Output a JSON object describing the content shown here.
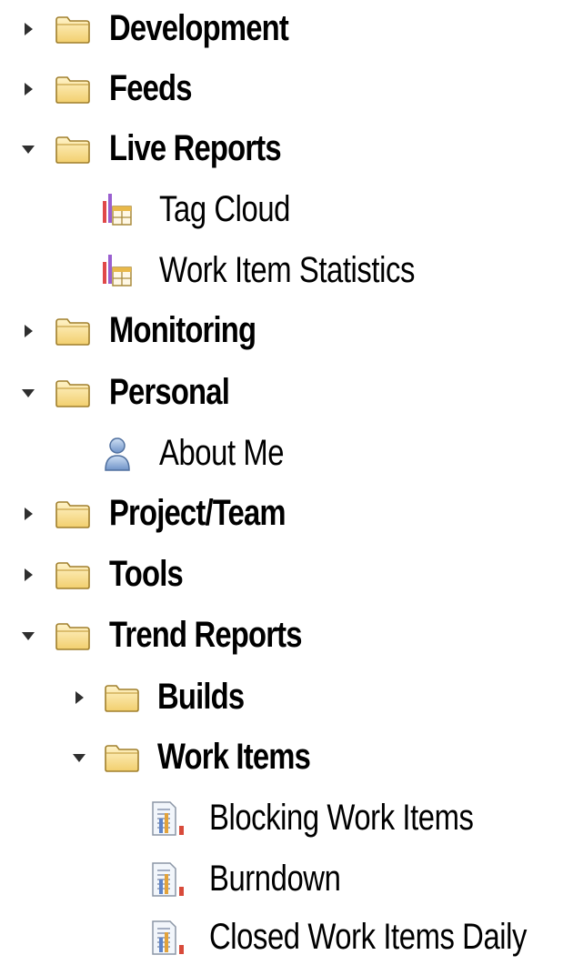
{
  "tree": {
    "development": {
      "label": "Development",
      "state": "collapsed",
      "icon": "folder-icon"
    },
    "feeds": {
      "label": "Feeds",
      "state": "collapsed",
      "icon": "folder-icon"
    },
    "live_reports": {
      "label": "Live Reports",
      "state": "expanded",
      "icon": "folder-icon",
      "children": {
        "tag_cloud": {
          "label": "Tag Cloud",
          "icon": "live-report-icon"
        },
        "work_item_statistics": {
          "label": "Work Item Statistics",
          "icon": "live-report-icon"
        }
      }
    },
    "monitoring": {
      "label": "Monitoring",
      "state": "collapsed",
      "icon": "folder-icon"
    },
    "personal": {
      "label": "Personal",
      "state": "expanded",
      "icon": "folder-icon",
      "children": {
        "about_me": {
          "label": "About Me",
          "icon": "user-icon"
        }
      }
    },
    "project_team": {
      "label": "Project/Team",
      "state": "collapsed",
      "icon": "folder-icon"
    },
    "tools": {
      "label": "Tools",
      "state": "collapsed",
      "icon": "folder-icon"
    },
    "trend_reports": {
      "label": "Trend Reports",
      "state": "expanded",
      "icon": "folder-icon",
      "children": {
        "builds": {
          "label": "Builds",
          "state": "collapsed",
          "icon": "folder-icon"
        },
        "work_items": {
          "label": "Work Items",
          "state": "expanded",
          "icon": "folder-icon",
          "children": {
            "blocking_work_items": {
              "label": "Blocking Work Items",
              "icon": "trend-report-icon"
            },
            "burndown": {
              "label": "Burndown",
              "icon": "trend-report-icon"
            },
            "closed_work_items_daily": {
              "label": "Closed Work Items Daily",
              "icon": "trend-report-icon"
            }
          }
        }
      }
    }
  },
  "colors": {
    "folder_fill": "#f7dc8c",
    "folder_stroke": "#9a7a2a",
    "arrow": "#333333"
  }
}
